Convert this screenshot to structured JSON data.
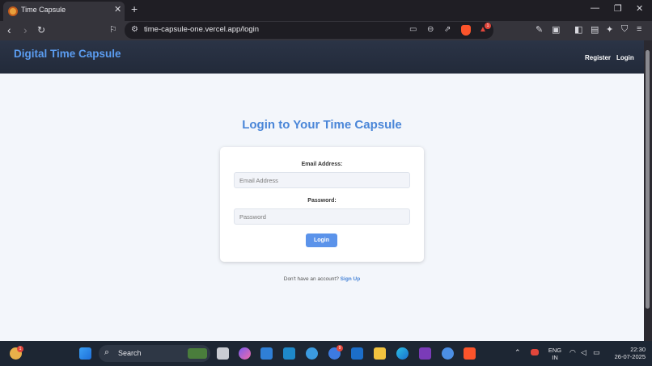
{
  "browser": {
    "tab_title": "Time Capsule",
    "tab_close": "✕",
    "new_tab": "+",
    "url": "time-capsule-one.vercel.app/login",
    "notification_count": "1"
  },
  "site": {
    "brand": "Digital Time Capsule",
    "nav": {
      "register": "Register",
      "login": "Login"
    }
  },
  "login": {
    "heading": "Login to Your Time Capsule",
    "email_label": "Email Address:",
    "email_placeholder": "Email Address",
    "password_label": "Password:",
    "password_placeholder": "Password",
    "button": "Login",
    "signup_prompt": "Don't have an account?",
    "signup_link": "Sign Up"
  },
  "taskbar": {
    "search": "Search",
    "language_line1": "ENG",
    "language_line2": "IN",
    "time": "22:30",
    "date": "26-07-2025",
    "weather_badge": "1",
    "chrome_badge": "9"
  },
  "colors": {
    "accent": "#4a86d8",
    "header_bg": "#2b3446",
    "button_bg": "#5b93ea",
    "page_bg": "#f3f6fb"
  }
}
